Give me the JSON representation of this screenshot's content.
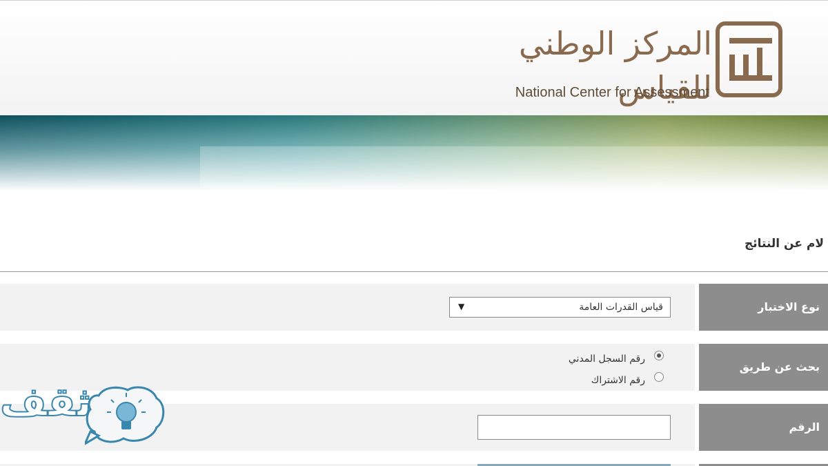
{
  "header": {
    "logo_ar": "المركز الوطني للقياس",
    "logo_en": "National Center for Assessment"
  },
  "page": {
    "title": "لام عن النتائج"
  },
  "form": {
    "test_type": {
      "label": "نوع الاختبار",
      "selected": "قياس القدرات العامة",
      "arrow": "▼"
    },
    "search_by": {
      "label": "بحث عن طريق",
      "options": [
        "رقم السجل المدني",
        "رقم الاشتراك"
      ],
      "selected_index": 0
    },
    "number": {
      "label": "الرقم",
      "value": ""
    }
  },
  "watermark": {
    "text": "ثقف"
  },
  "colors": {
    "brand_brown": "#8a6a4f",
    "label_gray": "#8d8d8d",
    "field_bg": "#f2f2f2",
    "watermark_blue": "#3a87ad"
  }
}
